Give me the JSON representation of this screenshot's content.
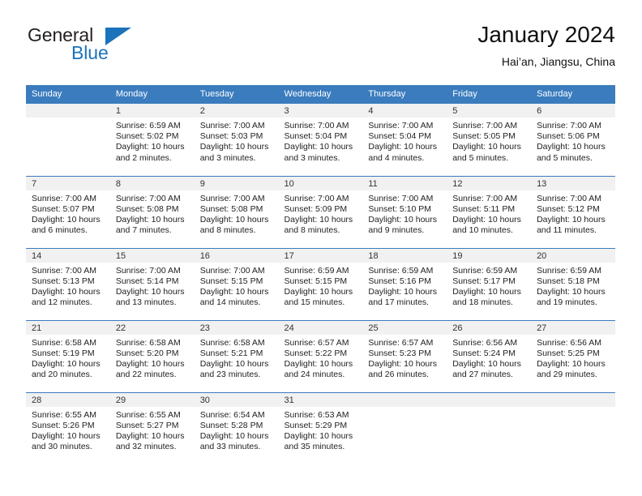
{
  "brand": {
    "name_part1": "General",
    "name_part2": "Blue",
    "flag_icon": "blue-triangle-flag-icon"
  },
  "header": {
    "title": "January 2024",
    "subtitle": "Hai’an, Jiangsu, China"
  },
  "colors": {
    "header_blue": "#3a7cbe",
    "brand_blue": "#1c72bb",
    "daynum_band": "#f1f1f1",
    "text": "#222222"
  },
  "calendar": {
    "weekdays": [
      "Sunday",
      "Monday",
      "Tuesday",
      "Wednesday",
      "Thursday",
      "Friday",
      "Saturday"
    ],
    "weeks": [
      [
        {
          "day": "",
          "sunrise": "",
          "sunset": "",
          "daylight1": "",
          "daylight2": "",
          "empty": true
        },
        {
          "day": "1",
          "sunrise": "Sunrise: 6:59 AM",
          "sunset": "Sunset: 5:02 PM",
          "daylight1": "Daylight: 10 hours",
          "daylight2": "and 2 minutes."
        },
        {
          "day": "2",
          "sunrise": "Sunrise: 7:00 AM",
          "sunset": "Sunset: 5:03 PM",
          "daylight1": "Daylight: 10 hours",
          "daylight2": "and 3 minutes."
        },
        {
          "day": "3",
          "sunrise": "Sunrise: 7:00 AM",
          "sunset": "Sunset: 5:04 PM",
          "daylight1": "Daylight: 10 hours",
          "daylight2": "and 3 minutes."
        },
        {
          "day": "4",
          "sunrise": "Sunrise: 7:00 AM",
          "sunset": "Sunset: 5:04 PM",
          "daylight1": "Daylight: 10 hours",
          "daylight2": "and 4 minutes."
        },
        {
          "day": "5",
          "sunrise": "Sunrise: 7:00 AM",
          "sunset": "Sunset: 5:05 PM",
          "daylight1": "Daylight: 10 hours",
          "daylight2": "and 5 minutes."
        },
        {
          "day": "6",
          "sunrise": "Sunrise: 7:00 AM",
          "sunset": "Sunset: 5:06 PM",
          "daylight1": "Daylight: 10 hours",
          "daylight2": "and 5 minutes."
        }
      ],
      [
        {
          "day": "7",
          "sunrise": "Sunrise: 7:00 AM",
          "sunset": "Sunset: 5:07 PM",
          "daylight1": "Daylight: 10 hours",
          "daylight2": "and 6 minutes."
        },
        {
          "day": "8",
          "sunrise": "Sunrise: 7:00 AM",
          "sunset": "Sunset: 5:08 PM",
          "daylight1": "Daylight: 10 hours",
          "daylight2": "and 7 minutes."
        },
        {
          "day": "9",
          "sunrise": "Sunrise: 7:00 AM",
          "sunset": "Sunset: 5:08 PM",
          "daylight1": "Daylight: 10 hours",
          "daylight2": "and 8 minutes."
        },
        {
          "day": "10",
          "sunrise": "Sunrise: 7:00 AM",
          "sunset": "Sunset: 5:09 PM",
          "daylight1": "Daylight: 10 hours",
          "daylight2": "and 8 minutes."
        },
        {
          "day": "11",
          "sunrise": "Sunrise: 7:00 AM",
          "sunset": "Sunset: 5:10 PM",
          "daylight1": "Daylight: 10 hours",
          "daylight2": "and 9 minutes."
        },
        {
          "day": "12",
          "sunrise": "Sunrise: 7:00 AM",
          "sunset": "Sunset: 5:11 PM",
          "daylight1": "Daylight: 10 hours",
          "daylight2": "and 10 minutes."
        },
        {
          "day": "13",
          "sunrise": "Sunrise: 7:00 AM",
          "sunset": "Sunset: 5:12 PM",
          "daylight1": "Daylight: 10 hours",
          "daylight2": "and 11 minutes."
        }
      ],
      [
        {
          "day": "14",
          "sunrise": "Sunrise: 7:00 AM",
          "sunset": "Sunset: 5:13 PM",
          "daylight1": "Daylight: 10 hours",
          "daylight2": "and 12 minutes."
        },
        {
          "day": "15",
          "sunrise": "Sunrise: 7:00 AM",
          "sunset": "Sunset: 5:14 PM",
          "daylight1": "Daylight: 10 hours",
          "daylight2": "and 13 minutes."
        },
        {
          "day": "16",
          "sunrise": "Sunrise: 7:00 AM",
          "sunset": "Sunset: 5:15 PM",
          "daylight1": "Daylight: 10 hours",
          "daylight2": "and 14 minutes."
        },
        {
          "day": "17",
          "sunrise": "Sunrise: 6:59 AM",
          "sunset": "Sunset: 5:15 PM",
          "daylight1": "Daylight: 10 hours",
          "daylight2": "and 15 minutes."
        },
        {
          "day": "18",
          "sunrise": "Sunrise: 6:59 AM",
          "sunset": "Sunset: 5:16 PM",
          "daylight1": "Daylight: 10 hours",
          "daylight2": "and 17 minutes."
        },
        {
          "day": "19",
          "sunrise": "Sunrise: 6:59 AM",
          "sunset": "Sunset: 5:17 PM",
          "daylight1": "Daylight: 10 hours",
          "daylight2": "and 18 minutes."
        },
        {
          "day": "20",
          "sunrise": "Sunrise: 6:59 AM",
          "sunset": "Sunset: 5:18 PM",
          "daylight1": "Daylight: 10 hours",
          "daylight2": "and 19 minutes."
        }
      ],
      [
        {
          "day": "21",
          "sunrise": "Sunrise: 6:58 AM",
          "sunset": "Sunset: 5:19 PM",
          "daylight1": "Daylight: 10 hours",
          "daylight2": "and 20 minutes."
        },
        {
          "day": "22",
          "sunrise": "Sunrise: 6:58 AM",
          "sunset": "Sunset: 5:20 PM",
          "daylight1": "Daylight: 10 hours",
          "daylight2": "and 22 minutes."
        },
        {
          "day": "23",
          "sunrise": "Sunrise: 6:58 AM",
          "sunset": "Sunset: 5:21 PM",
          "daylight1": "Daylight: 10 hours",
          "daylight2": "and 23 minutes."
        },
        {
          "day": "24",
          "sunrise": "Sunrise: 6:57 AM",
          "sunset": "Sunset: 5:22 PM",
          "daylight1": "Daylight: 10 hours",
          "daylight2": "and 24 minutes."
        },
        {
          "day": "25",
          "sunrise": "Sunrise: 6:57 AM",
          "sunset": "Sunset: 5:23 PM",
          "daylight1": "Daylight: 10 hours",
          "daylight2": "and 26 minutes."
        },
        {
          "day": "26",
          "sunrise": "Sunrise: 6:56 AM",
          "sunset": "Sunset: 5:24 PM",
          "daylight1": "Daylight: 10 hours",
          "daylight2": "and 27 minutes."
        },
        {
          "day": "27",
          "sunrise": "Sunrise: 6:56 AM",
          "sunset": "Sunset: 5:25 PM",
          "daylight1": "Daylight: 10 hours",
          "daylight2": "and 29 minutes."
        }
      ],
      [
        {
          "day": "28",
          "sunrise": "Sunrise: 6:55 AM",
          "sunset": "Sunset: 5:26 PM",
          "daylight1": "Daylight: 10 hours",
          "daylight2": "and 30 minutes."
        },
        {
          "day": "29",
          "sunrise": "Sunrise: 6:55 AM",
          "sunset": "Sunset: 5:27 PM",
          "daylight1": "Daylight: 10 hours",
          "daylight2": "and 32 minutes."
        },
        {
          "day": "30",
          "sunrise": "Sunrise: 6:54 AM",
          "sunset": "Sunset: 5:28 PM",
          "daylight1": "Daylight: 10 hours",
          "daylight2": "and 33 minutes."
        },
        {
          "day": "31",
          "sunrise": "Sunrise: 6:53 AM",
          "sunset": "Sunset: 5:29 PM",
          "daylight1": "Daylight: 10 hours",
          "daylight2": "and 35 minutes."
        },
        {
          "day": "",
          "sunrise": "",
          "sunset": "",
          "daylight1": "",
          "daylight2": "",
          "empty": true
        },
        {
          "day": "",
          "sunrise": "",
          "sunset": "",
          "daylight1": "",
          "daylight2": "",
          "empty": true
        },
        {
          "day": "",
          "sunrise": "",
          "sunset": "",
          "daylight1": "",
          "daylight2": "",
          "empty": true
        }
      ]
    ]
  }
}
